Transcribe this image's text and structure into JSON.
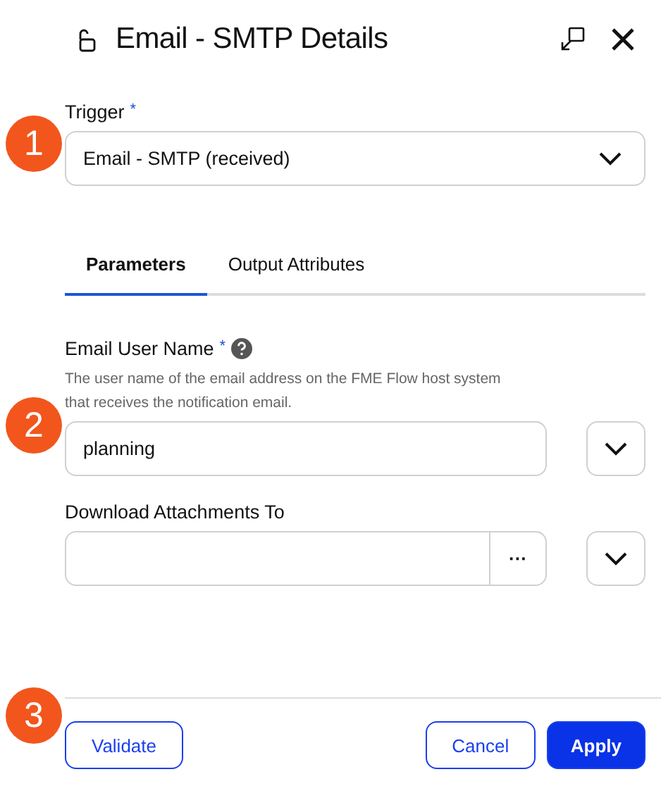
{
  "header": {
    "title": "Email - SMTP Details"
  },
  "trigger": {
    "label": "Trigger",
    "required_mark": "*",
    "value": "Email - SMTP (received)"
  },
  "tabs": [
    {
      "label": "Parameters",
      "selected": true
    },
    {
      "label": "Output Attributes",
      "selected": false
    }
  ],
  "parameters": [
    {
      "kind": "text",
      "label": "Email User Name",
      "required_mark": "*",
      "help": true,
      "description": "The user name of the email address on the FME Flow host system that receives the notification email.",
      "value": "planning"
    },
    {
      "kind": "browse",
      "label": "Download Attachments To",
      "browse": "···"
    }
  ],
  "footer": {
    "buttons": [
      {
        "label": "Validate",
        "kind": "outline"
      },
      {
        "label": "Cancel",
        "kind": "outline"
      },
      {
        "label": "Apply",
        "kind": "primary"
      }
    ]
  },
  "callouts": [
    "1",
    "2",
    "3"
  ]
}
